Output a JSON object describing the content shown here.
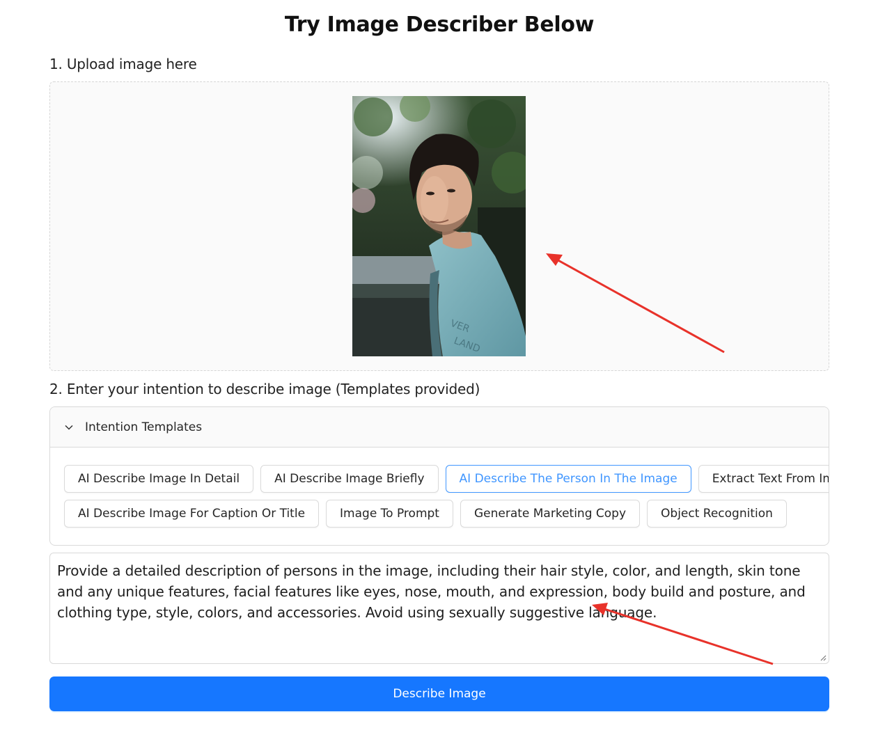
{
  "page": {
    "title": "Try Image Describer Below"
  },
  "upload": {
    "step_label": "1. Upload image here"
  },
  "intention": {
    "step_label": "2. Enter your intention to describe image (Templates provided)",
    "collapse_title": "Intention Templates",
    "collapse_icon": "chevron-down-icon",
    "templates": [
      {
        "label": "AI Describe Image In Detail",
        "active": false
      },
      {
        "label": "AI Describe Image Briefly",
        "active": false
      },
      {
        "label": "AI Describe The Person In The Image",
        "active": true
      },
      {
        "label": "Extract Text From Image",
        "active": false
      },
      {
        "label": "AI Describe Image For Caption Or Title",
        "active": false
      },
      {
        "label": "Image To Prompt",
        "active": false
      },
      {
        "label": "Generate Marketing Copy",
        "active": false
      },
      {
        "label": "Object Recognition",
        "active": false
      }
    ],
    "prompt_text": "Provide a detailed description of persons in the image, including their hair style, color, and length, skin tone and any unique features, facial features like eyes, nose, mouth, and expression, body build and posture, and clothing type, style, colors, and accessories. Avoid using sexually suggestive language."
  },
  "actions": {
    "describe_label": "Describe Image"
  },
  "colors": {
    "primary": "#1677ff",
    "active_template": "#4096ff",
    "annotation_arrow": "#e8322a"
  }
}
